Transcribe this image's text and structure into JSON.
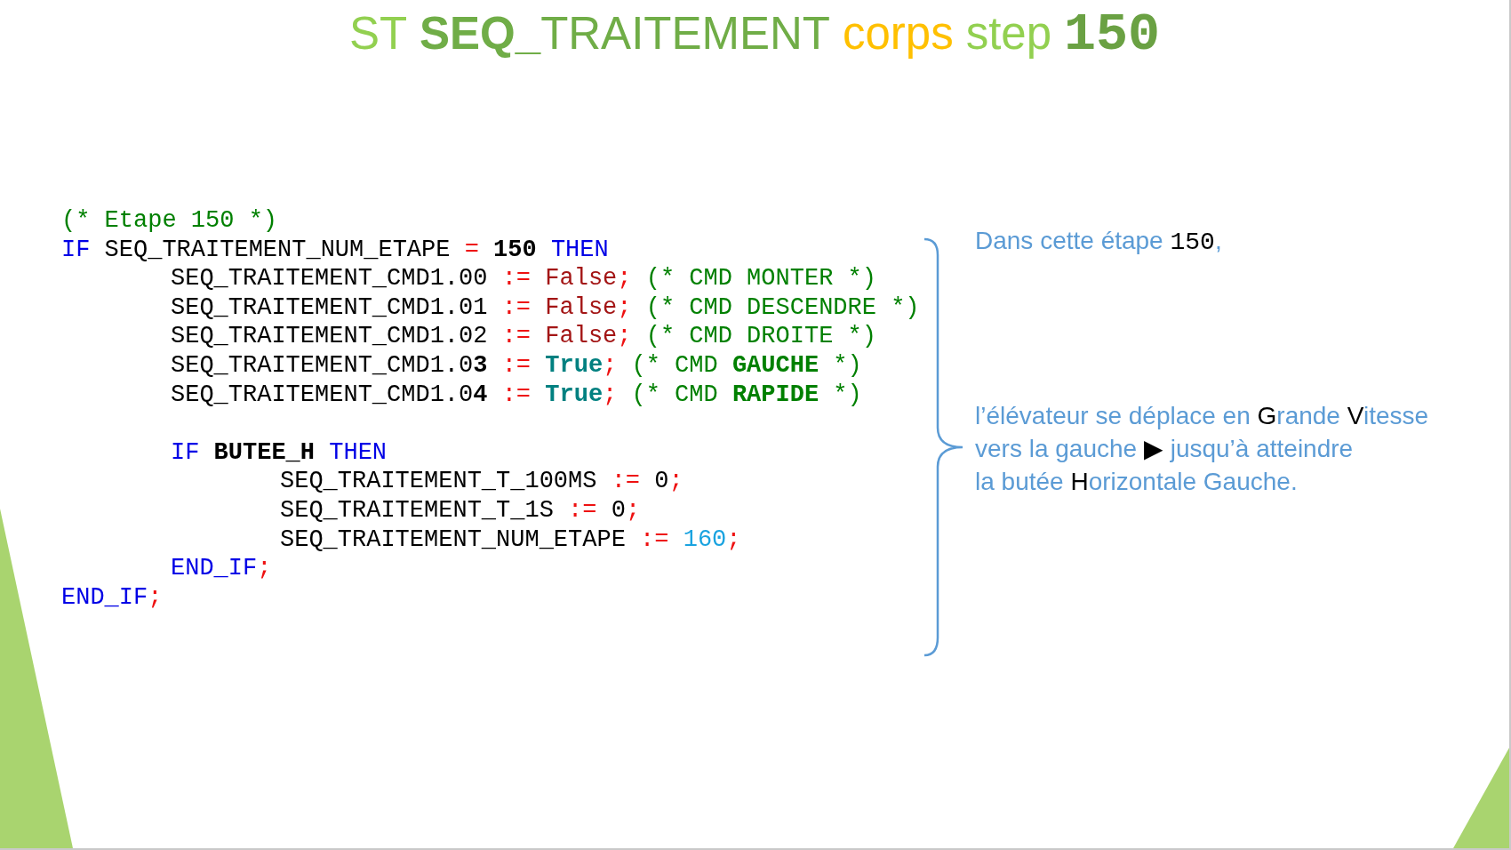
{
  "title": {
    "segments": [
      {
        "kind": "word",
        "text": "ST",
        "color": "#92d050"
      },
      {
        "kind": "word",
        "text": "**SEQ_**TRAITEMENT",
        "color": "#70ad47"
      },
      {
        "kind": "word",
        "text": "corps",
        "color": "#ffc000"
      },
      {
        "kind": "word",
        "text": "step",
        "color": "#92d050"
      },
      {
        "kind": "number",
        "text": "150",
        "color": "#6aa143"
      }
    ]
  },
  "code": {
    "lines": [
      {
        "kind": "code",
        "tokens": [
          {
            "kind": "comment",
            "text": "(* Etape 150 *)"
          }
        ]
      },
      {
        "kind": "code",
        "tokens": [
          {
            "kind": "keyword",
            "text": "IF "
          },
          {
            "kind": "plain",
            "text": "SEQ_TRAITEMENT_NUM_ETAPE "
          },
          {
            "kind": "operator",
            "text": "= "
          },
          {
            "kind": "plain",
            "text": "**150** "
          },
          {
            "kind": "keyword",
            "text": "THEN"
          }
        ],
        "children": [
          {
            "kind": "code",
            "tokens": [
              {
                "kind": "plain",
                "text": "SEQ_TRAITEMENT_CMD1.00 "
              },
              {
                "kind": "operator",
                "text": ":= "
              },
              {
                "kind": "false",
                "text": "False"
              },
              {
                "kind": "operator",
                "text": "; "
              },
              {
                "kind": "comment",
                "text": "(* CMD MONTER *)"
              }
            ]
          },
          {
            "kind": "code",
            "tokens": [
              {
                "kind": "plain",
                "text": "SEQ_TRAITEMENT_CMD1.01 "
              },
              {
                "kind": "operator",
                "text": ":= "
              },
              {
                "kind": "false",
                "text": "False"
              },
              {
                "kind": "operator",
                "text": "; "
              },
              {
                "kind": "comment",
                "text": "(* CMD DESCENDRE *)"
              }
            ]
          },
          {
            "kind": "code",
            "tokens": [
              {
                "kind": "plain",
                "text": "SEQ_TRAITEMENT_CMD1.02 "
              },
              {
                "kind": "operator",
                "text": ":= "
              },
              {
                "kind": "false",
                "text": "False"
              },
              {
                "kind": "operator",
                "text": "; "
              },
              {
                "kind": "comment",
                "text": "(* CMD DROITE *)"
              }
            ]
          },
          {
            "kind": "code",
            "tokens": [
              {
                "kind": "plain",
                "text": "SEQ_TRAITEMENT_CMD1.0**3** "
              },
              {
                "kind": "operator",
                "text": ":= "
              },
              {
                "kind": "true",
                "text": "True"
              },
              {
                "kind": "operator",
                "text": "; "
              },
              {
                "kind": "comment",
                "text": "(* CMD **GAUCHE** *)"
              }
            ]
          },
          {
            "kind": "code",
            "tokens": [
              {
                "kind": "plain",
                "text": "SEQ_TRAITEMENT_CMD1.0**4** "
              },
              {
                "kind": "operator",
                "text": ":= "
              },
              {
                "kind": "true",
                "text": "True"
              },
              {
                "kind": "operator",
                "text": "; "
              },
              {
                "kind": "comment",
                "text": "(* CMD **RAPIDE** *)"
              }
            ]
          },
          {
            "kind": "blank"
          },
          {
            "kind": "code",
            "tokens": [
              {
                "kind": "keyword",
                "text": "IF "
              },
              {
                "kind": "plain",
                "text": "**BUTEE_H** "
              },
              {
                "kind": "keyword",
                "text": "THEN"
              }
            ],
            "children": [
              {
                "kind": "code",
                "tokens": [
                  {
                    "kind": "plain",
                    "text": "SEQ_TRAITEMENT_T_100MS "
                  },
                  {
                    "kind": "operator",
                    "text": ":= "
                  },
                  {
                    "kind": "plain",
                    "text": "0"
                  },
                  {
                    "kind": "operator",
                    "text": ";"
                  }
                ]
              },
              {
                "kind": "code",
                "tokens": [
                  {
                    "kind": "plain",
                    "text": "SEQ_TRAITEMENT_T_1S "
                  },
                  {
                    "kind": "operator",
                    "text": ":= "
                  },
                  {
                    "kind": "plain",
                    "text": "0"
                  },
                  {
                    "kind": "operator",
                    "text": ";"
                  }
                ]
              },
              {
                "kind": "code",
                "tokens": [
                  {
                    "kind": "plain",
                    "text": "SEQ_TRAITEMENT_NUM_ETAPE "
                  },
                  {
                    "kind": "operator",
                    "text": ":= "
                  },
                  {
                    "kind": "number",
                    "text": "160"
                  },
                  {
                    "kind": "operator",
                    "text": ";"
                  }
                ]
              }
            ]
          },
          {
            "kind": "code",
            "tokens": [
              {
                "kind": "keyword",
                "text": "END_IF"
              },
              {
                "kind": "operator",
                "text": ";"
              }
            ]
          }
        ]
      },
      {
        "kind": "code",
        "tokens": [
          {
            "kind": "keyword",
            "text": "END_IF"
          },
          {
            "kind": "operator",
            "text": ";"
          }
        ]
      }
    ]
  },
  "note": {
    "paragraphs": [
      {
        "lines": [
          {
            "segments": [
              {
                "kind": "plain",
                "text": "Dans cette étape "
              },
              {
                "kind": "code",
                "text": "150"
              },
              {
                "kind": "plain",
                "text": ","
              }
            ]
          }
        ]
      },
      {
        "lines": [
          {
            "segments": [
              {
                "kind": "plain",
                "text": "l’élévateur se déplace en "
              },
              {
                "kind": "key",
                "text": "G"
              },
              {
                "kind": "plain",
                "text": "rande "
              },
              {
                "kind": "key",
                "text": "V"
              },
              {
                "kind": "plain",
                "text": "itesse"
              }
            ]
          },
          {
            "segments": [
              {
                "kind": "plain",
                "text": "vers la gauche "
              },
              {
                "kind": "key",
                "text": "▶"
              },
              {
                "kind": "plain",
                "text": " jusqu’à atteindre"
              }
            ]
          },
          {
            "segments": [
              {
                "kind": "plain",
                "text": "la butée "
              },
              {
                "kind": "key",
                "text": "H"
              },
              {
                "kind": "plain",
                "text": "orizontale Gauche."
              }
            ]
          }
        ]
      }
    ]
  }
}
